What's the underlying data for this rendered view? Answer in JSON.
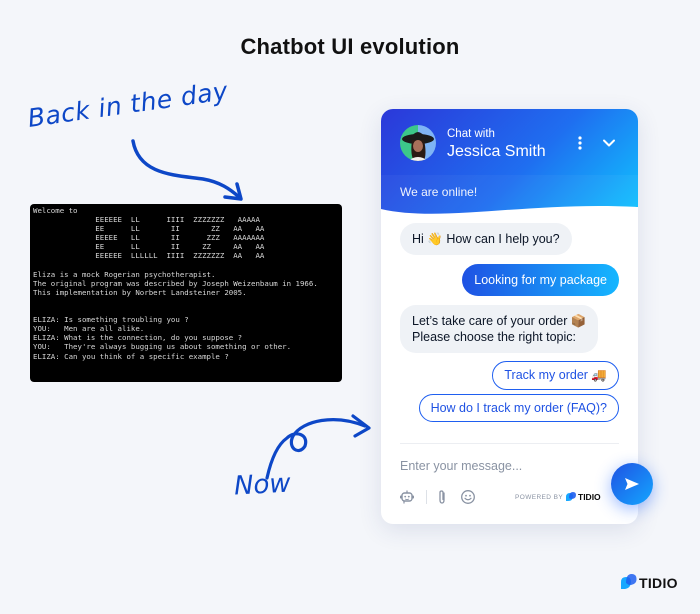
{
  "page": {
    "title": "Chatbot UI evolution",
    "label_old": "Back in the day",
    "label_new": "Now"
  },
  "terminal": {
    "lines": [
      "Welcome to",
      "              EEEEEE  LL      IIII  ZZZZZZZ   AAAAA",
      "              EE      LL       II       ZZ   AA   AA",
      "              EEEEE   LL       II      ZZZ   AAAAAAA",
      "              EE      LL       II     ZZ     AA   AA",
      "              EEEEEE  LLLLLL  IIII  ZZZZZZZ  AA   AA",
      "",
      "Eliza is a mock Rogerian psychotherapist.",
      "The original program was described by Joseph Weizenbaum in 1966.",
      "This implementation by Norbert Landsteiner 2005.",
      "",
      "",
      "ELIZA: Is something troubling you ?",
      "YOU:   Men are all alike.",
      "ELIZA: What is the connection, do you suppose ?",
      "YOU:   They're always bugging us about something or other.",
      "ELIZA: Can you think of a specific example ?"
    ]
  },
  "widget": {
    "header": {
      "subtitle": "Chat with",
      "agent_name": "Jessica Smith",
      "status": "We are online!",
      "menu_icon": "more-vertical-icon",
      "collapse_icon": "chevron-down-icon"
    },
    "messages": [
      {
        "from": "bot",
        "text": "Hi 👋 How can I help you?"
      },
      {
        "from": "user",
        "text": "Looking for my package"
      },
      {
        "from": "bot",
        "text_line1": "Let’s take care of your order 📦",
        "text_line2": "Please choose the right topic:"
      }
    ],
    "options": [
      {
        "label": "Track my order 🚚"
      },
      {
        "label": "How do I track my order (FAQ)?"
      }
    ],
    "composer": {
      "placeholder": "Enter your message...",
      "tools": [
        "bot-icon",
        "paperclip-icon",
        "emoji-icon"
      ],
      "powered_by": "POWERED BY",
      "powered_brand": "TIDIO",
      "send_icon": "send-icon"
    },
    "colors": {
      "accent": "#1f52e3",
      "accent_light": "#15b6ff",
      "bot_bubble": "#eff2f6"
    }
  },
  "brand": {
    "name": "TIDIO"
  }
}
